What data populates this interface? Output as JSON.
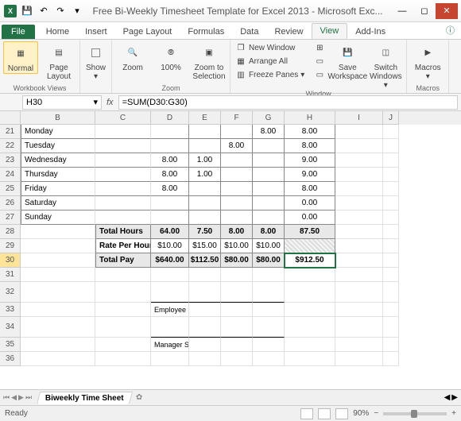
{
  "window": {
    "title": "Free Bi-Weekly Timesheet Template for Excel 2013 - Microsoft Exc..."
  },
  "qat": {
    "save": "💾",
    "undo": "↶",
    "redo": "↷"
  },
  "tabs": {
    "file": "File",
    "home": "Home",
    "insert": "Insert",
    "pagelayout": "Page Layout",
    "formulas": "Formulas",
    "data": "Data",
    "review": "Review",
    "view": "View",
    "addins": "Add-Ins"
  },
  "ribbon": {
    "wbv": {
      "label": "Workbook Views",
      "normal": "Normal",
      "pagelayout": "Page Layout"
    },
    "show": {
      "label": "Show"
    },
    "zoom": {
      "label": "Zoom",
      "zoom": "Zoom",
      "hundred": "100%",
      "zoomsel": "Zoom to Selection"
    },
    "window": {
      "label": "Window",
      "newwin": "New Window",
      "arrange": "Arrange All",
      "freeze": "Freeze Panes",
      "savews": "Save Workspace",
      "switch": "Switch Windows"
    },
    "macros": {
      "label": "Macros",
      "macros": "Macros"
    }
  },
  "namebox": "H30",
  "formula": "=SUM(D30:G30)",
  "cols": {
    "B": "B",
    "C": "C",
    "D": "D",
    "E": "E",
    "F": "F",
    "G": "G",
    "H": "H",
    "I": "I",
    "J": "J"
  },
  "rows": {
    "r21": "21",
    "r22": "22",
    "r23": "23",
    "r24": "24",
    "r25": "25",
    "r26": "26",
    "r27": "27",
    "r28": "28",
    "r29": "29",
    "r30": "30",
    "r31": "31",
    "r32": "32",
    "r33": "33",
    "r34": "34",
    "r35": "35",
    "r36": "36"
  },
  "sheet": {
    "days": {
      "mon": "Monday",
      "tue": "Tuesday",
      "wed": "Wednesday",
      "thu": "Thursday",
      "fri": "Friday",
      "sat": "Saturday",
      "sun": "Sunday"
    },
    "monG": "8.00",
    "monH": "8.00",
    "tueF": "8.00",
    "tueH": "8.00",
    "wedD": "8.00",
    "wedE": "1.00",
    "wedH": "9.00",
    "thuD": "8.00",
    "thuE": "1.00",
    "thuH": "9.00",
    "friD": "8.00",
    "friH": "8.00",
    "satH": "0.00",
    "sunH": "0.00",
    "totalhours_lbl": "Total Hours",
    "th_D": "64.00",
    "th_E": "7.50",
    "th_F": "8.00",
    "th_G": "8.00",
    "th_H": "87.50",
    "rate_lbl": "Rate Per Hour",
    "r_D": "$10.00",
    "r_E": "$15.00",
    "r_F": "$10.00",
    "r_G": "$10.00",
    "totalpay_lbl": "Total Pay",
    "tp_D": "$640.00",
    "tp_E": "$112.50",
    "tp_F": "$80.00",
    "tp_G": "$80.00",
    "tp_H": "$912.50",
    "emp_sig": "Employee Signature",
    "mgr_sig": "Manager Signature"
  },
  "sheettab": "Biweekly Time Sheet",
  "status": {
    "ready": "Ready",
    "zoom": "90%"
  }
}
